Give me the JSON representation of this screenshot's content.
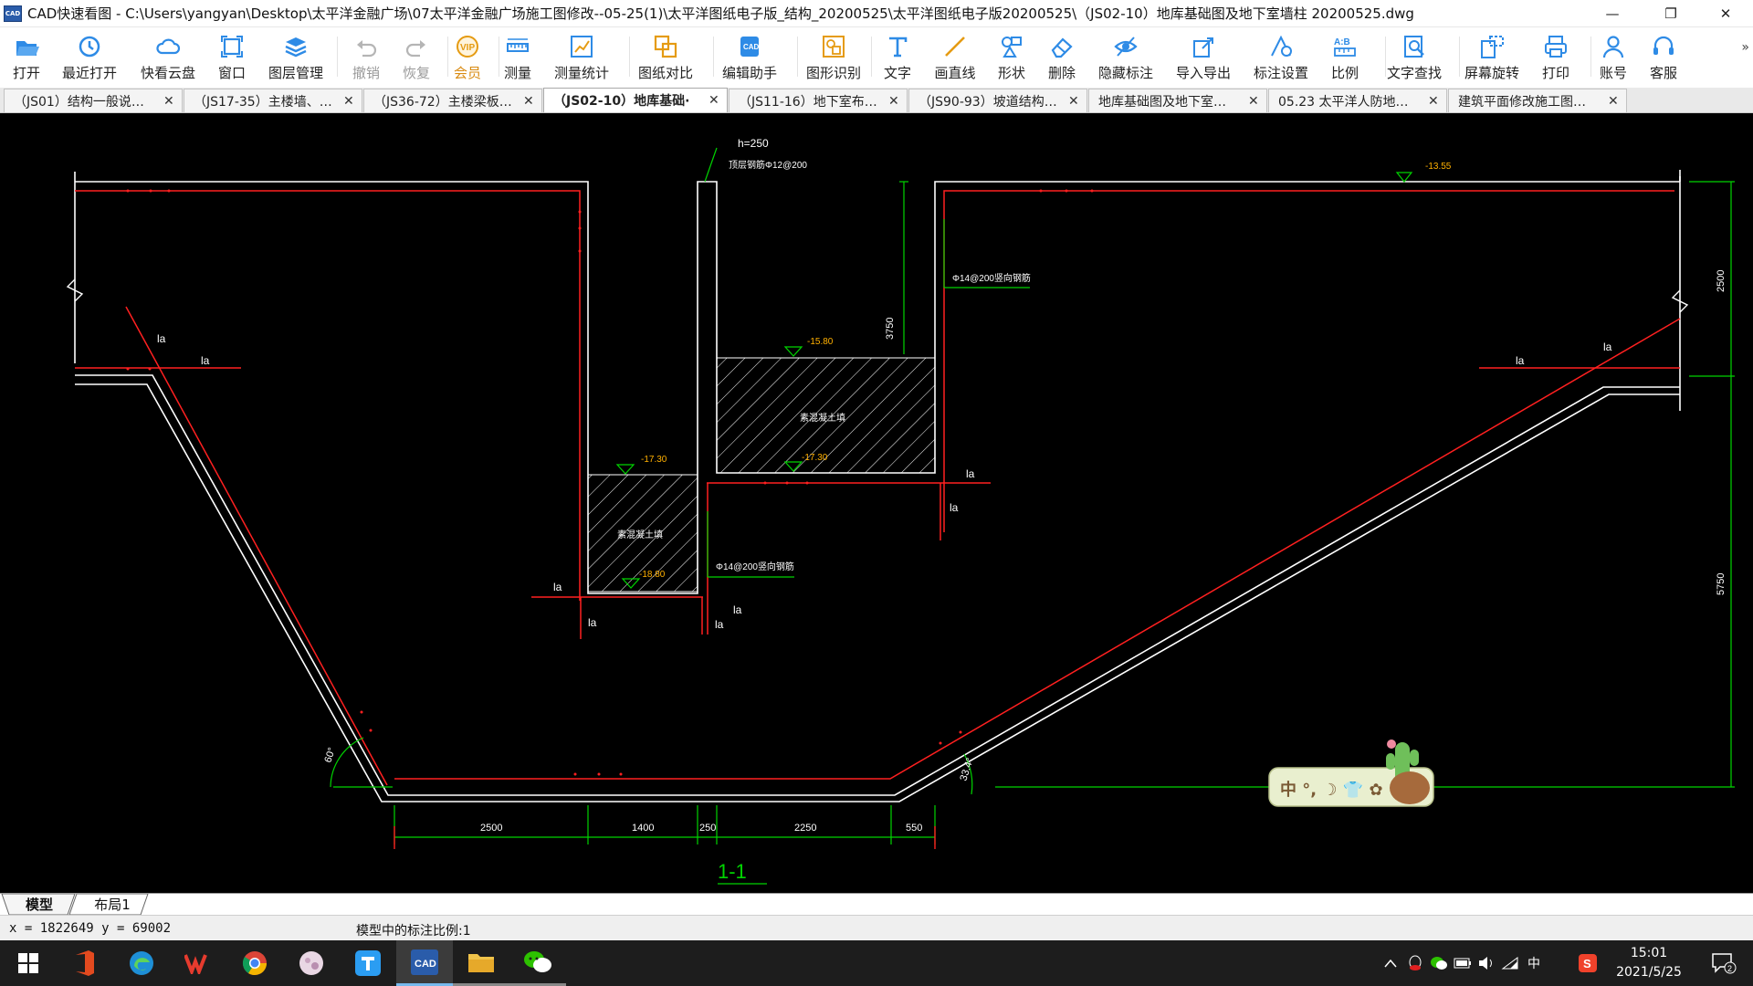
{
  "window": {
    "title": "CAD快速看图 - C:\\Users\\yangyan\\Desktop\\太平洋金融广场\\07太平洋金融广场施工图修改--05-25(1)\\太平洋图纸电子版_结构_20200525\\太平洋图纸电子版20200525\\（JS02-10）地库基础图及地下室墙柱 20200525.dwg",
    "app_icon_text": "CAD",
    "minimize": "—",
    "maximize": "❐",
    "close": "✕"
  },
  "toolbar": {
    "items": [
      {
        "label": "打开",
        "icon": "folder-open-icon"
      },
      {
        "label": "最近打开",
        "icon": "recent-clock-icon"
      },
      {
        "label": "快看云盘",
        "icon": "cloud-icon"
      },
      {
        "label": "窗口",
        "icon": "window-icon"
      },
      {
        "label": "图层管理",
        "icon": "layers-icon"
      },
      {
        "label": "撤销",
        "icon": "undo-icon"
      },
      {
        "label": "恢复",
        "icon": "redo-icon"
      },
      {
        "label": "会员",
        "icon": "vip-icon"
      },
      {
        "label": "测量",
        "icon": "ruler-icon"
      },
      {
        "label": "测量统计",
        "icon": "measure-stats-icon"
      },
      {
        "label": "图纸对比",
        "icon": "compare-icon"
      },
      {
        "label": "编辑助手",
        "icon": "edit-assistant-icon"
      },
      {
        "label": "图形识别",
        "icon": "shape-recognize-icon"
      },
      {
        "label": "文字",
        "icon": "text-icon"
      },
      {
        "label": "画直线",
        "icon": "line-icon"
      },
      {
        "label": "形状",
        "icon": "shapes-icon"
      },
      {
        "label": "删除",
        "icon": "eraser-icon"
      },
      {
        "label": "隐藏标注",
        "icon": "hide-eye-icon"
      },
      {
        "label": "导入导出",
        "icon": "import-export-icon"
      },
      {
        "label": "标注设置",
        "icon": "annotation-settings-icon"
      },
      {
        "label": "比例",
        "icon": "scale-icon"
      },
      {
        "label": "文字查找",
        "icon": "text-search-icon"
      },
      {
        "label": "屏幕旋转",
        "icon": "rotate-screen-icon"
      },
      {
        "label": "打印",
        "icon": "printer-icon"
      },
      {
        "label": "账号",
        "icon": "user-icon"
      },
      {
        "label": "客服",
        "icon": "headset-icon"
      }
    ],
    "more": "»"
  },
  "tabs": [
    {
      "label": "（JS01）结构一般说…",
      "close": "✕"
    },
    {
      "label": "（JS17-35）主楼墙、…",
      "close": "✕"
    },
    {
      "label": "（JS36-72）主楼梁板…",
      "close": "✕"
    },
    {
      "label": "（JS02-10）地库基础·",
      "close": "✕",
      "active": true
    },
    {
      "label": "（JS11-16）地下室布…",
      "close": "✕"
    },
    {
      "label": "（JS90-93）坡道结构…",
      "close": "✕"
    },
    {
      "label": "地库基础图及地下室…",
      "close": "✕"
    },
    {
      "label": "05.23 太平洋人防地…",
      "close": "✕"
    },
    {
      "label": "建筑平面修改施工图…",
      "close": "✕"
    }
  ],
  "drawing": {
    "background": "#000000",
    "annotations": {
      "h_label": "h=250",
      "top_rebar": "顶层钢筋Φ12@200",
      "wall_rebar_right": "Φ14@200竖向钢筋",
      "wall_rebar_left": "Φ14@200竖向钢筋",
      "elev_top": "-13.55",
      "elev_pit_left_top": "-17.30",
      "elev_pit_left_bottom": "-18.80",
      "elev_pit_right_top": "-15.80",
      "elev_pit_right_bottom": "-17.30",
      "pit_left_fill": "素混凝土填",
      "pit_right_fill": "素混凝土填",
      "la": "la",
      "dim_3750": "3750",
      "dim_2500_v": "2500",
      "dim_5750": "5750",
      "angle_left": "60°",
      "angle_right": "33.4°",
      "bottom_dims": [
        "2500",
        "1400",
        "250",
        "2250",
        "550"
      ],
      "section_label": "1-1"
    },
    "colors": {
      "concrete": "#ffffff",
      "rebar": "#ff2020",
      "dimension": "#00d400",
      "text": "#ffffff",
      "elevation_text": "#ffb000",
      "hatch": "#ffffff"
    }
  },
  "ime_widget": {
    "label": "中 °, ☽ 👕 ✿",
    "icon": "cactus-pot-icon"
  },
  "layout_tabs": [
    "模型",
    "布局1"
  ],
  "status": {
    "coords": "x = 1822649  y = 69002",
    "scale": "模型中的标注比例:1"
  },
  "taskbar": {
    "apps": [
      "start-windows-icon",
      "office-icon",
      "edge-icon",
      "wps-icon",
      "chrome-icon",
      "photo-icon",
      "tencent-docs-icon",
      "cad-viewer-icon",
      "file-explorer-icon",
      "wechat-icon"
    ],
    "tray_ime": "中",
    "time": "15:01",
    "date": "2021/5/25",
    "notification_count": "2"
  }
}
